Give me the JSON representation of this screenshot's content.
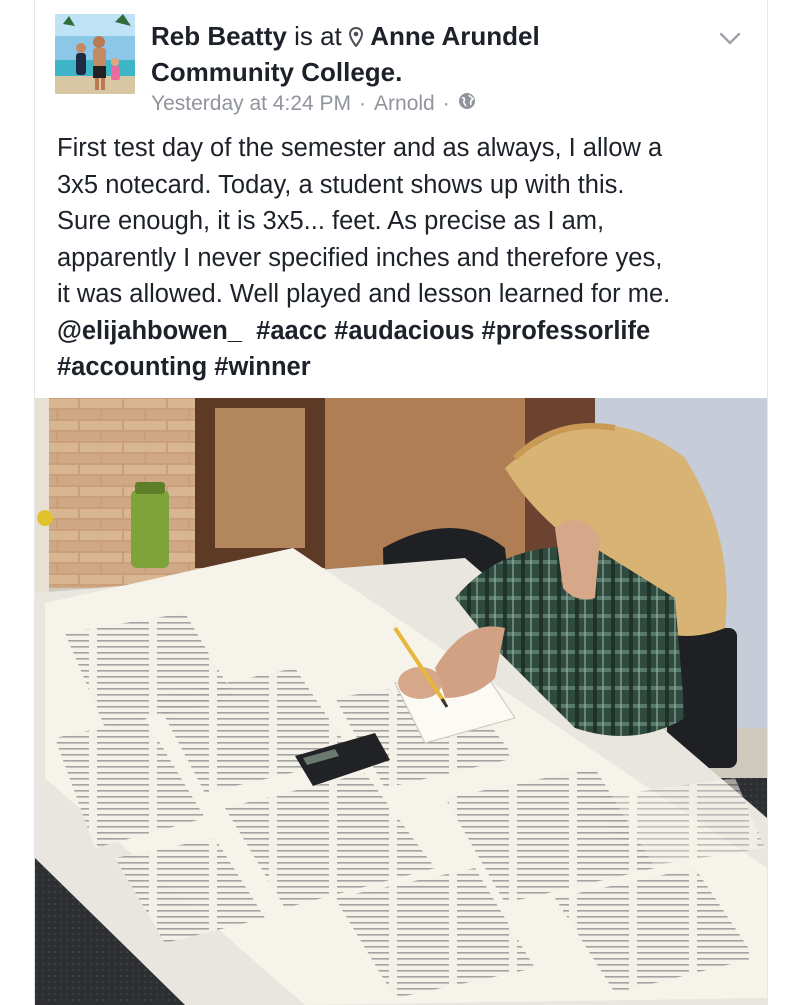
{
  "post": {
    "author_name": "Reb Beatty",
    "is_at": "is at",
    "place": "Anne Arundel",
    "place_2": "Community College.",
    "timestamp": "Yesterday at 4:24 PM",
    "separator": "·",
    "location": "Arnold",
    "privacy_icon": "globe-icon",
    "menu_icon": "chevron-down-icon",
    "text_lines": [
      "First test day of the semester and as always, I allow a",
      "3x5 notecard.  Today, a student shows up with this.",
      "Sure enough, it is 3x5... feet.  As precise as I am,",
      "apparently I never specified inches and therefore yes,",
      "it was allowed.  Well played and lesson learned for me."
    ],
    "mention": "@elijahbowen_",
    "hashtags_line1": "#aacc #audacious #professorlife",
    "hashtags_line2": "#accounting #winner"
  },
  "colors": {
    "text": "#1d2129",
    "meta": "#90949c",
    "border": "#e6e7ea"
  }
}
